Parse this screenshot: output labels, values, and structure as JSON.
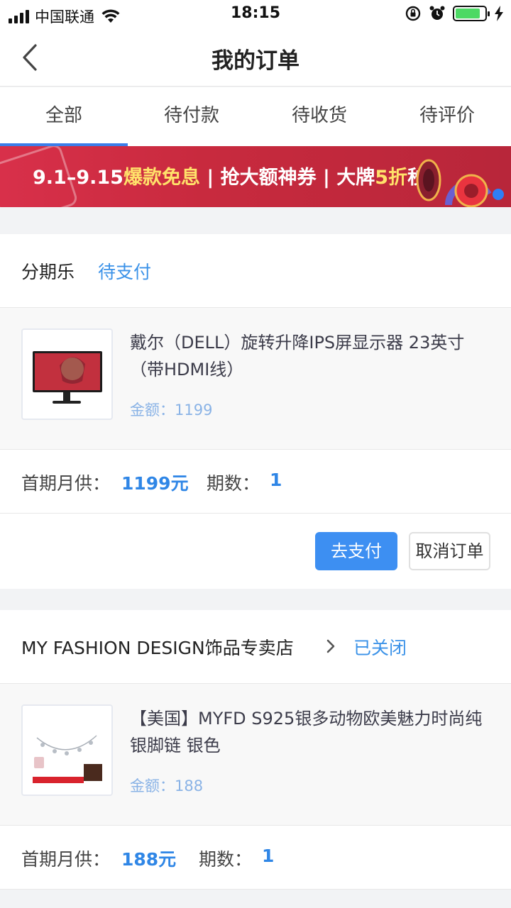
{
  "status_bar": {
    "carrier": "中国联通",
    "time": "18:15",
    "battery_level": 0.85
  },
  "nav": {
    "title": "我的订单"
  },
  "tabs": [
    {
      "label": "全部",
      "active": true
    },
    {
      "label": "待付款",
      "active": false
    },
    {
      "label": "待收货",
      "active": false
    },
    {
      "label": "待评价",
      "active": false
    }
  ],
  "banner": {
    "date": "9.1–9.15",
    "hl1": "爆款免息",
    "sep1": " | 抢大额神券 | 大牌",
    "hl2": "5折",
    "tail": "秒"
  },
  "orders": [
    {
      "store": "分期乐",
      "status": "待支付",
      "product_title": "戴尔（DELL）旋转升降IPS屏显示器 23英寸（带HDMI线）",
      "amount": "金额：1199",
      "first_payment_label": "首期月供：",
      "first_payment_value": "1199元",
      "periods_label": "期数：",
      "periods_value": "1",
      "pay_button": "去支付",
      "cancel_button": "取消订单"
    },
    {
      "store": "MY FASHION DESIGN饰品专卖店",
      "status": "已关闭",
      "product_title": "【美国】MYFD S925银多动物欧美魅力时尚纯银脚链 银色",
      "amount": "金额：188",
      "first_payment_label": "首期月供：",
      "first_payment_value": "188元",
      "periods_label": "期数：",
      "periods_value": "1"
    }
  ],
  "colors": {
    "accent": "#3b7de9",
    "status": "#3b92e8",
    "pay_button": "#3d8ff2",
    "banner": "#c82a3e"
  }
}
